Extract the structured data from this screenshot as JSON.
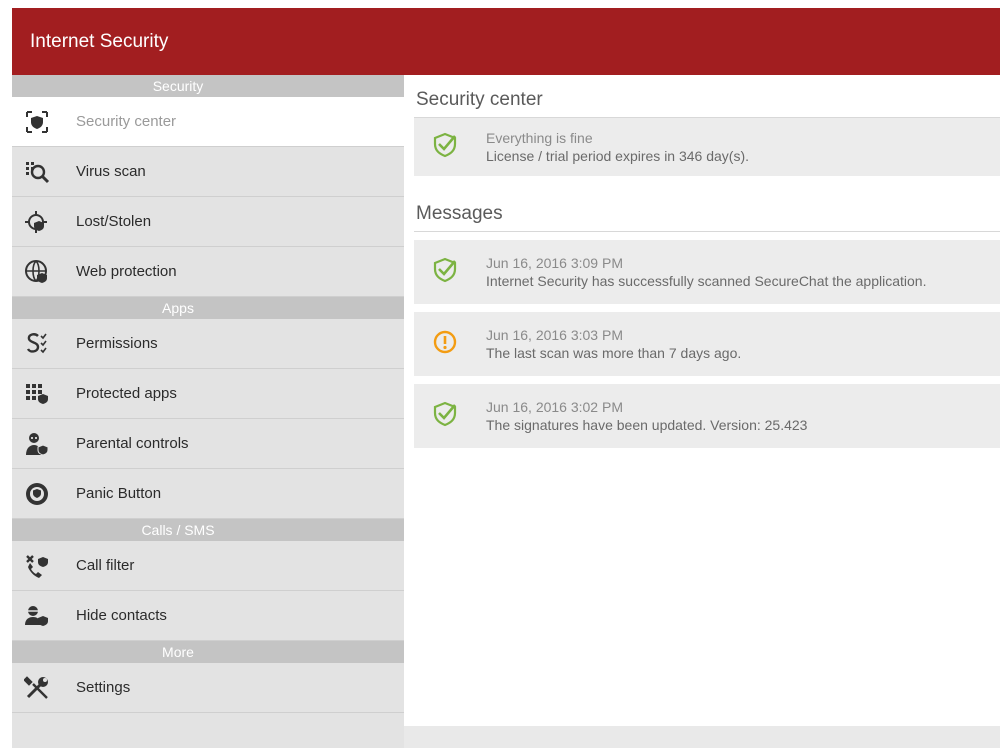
{
  "app": {
    "title": "Internet Security"
  },
  "colors": {
    "brand": "#a21e20",
    "ok": "#7cb342",
    "warning": "#f39c12"
  },
  "sidebar": {
    "sections": [
      {
        "header": "Security",
        "items": [
          {
            "label": "Security center",
            "icon": "shield-scan-icon",
            "active": true
          },
          {
            "label": "Virus scan",
            "icon": "virus-scan-icon"
          },
          {
            "label": "Lost/Stolen",
            "icon": "lost-stolen-icon"
          },
          {
            "label": "Web protection",
            "icon": "globe-shield-icon"
          }
        ]
      },
      {
        "header": "Apps",
        "items": [
          {
            "label": "Permissions",
            "icon": "permissions-icon"
          },
          {
            "label": "Protected apps",
            "icon": "protected-apps-icon"
          },
          {
            "label": "Parental controls",
            "icon": "parental-controls-icon"
          },
          {
            "label": "Panic Button",
            "icon": "panic-button-icon"
          }
        ]
      },
      {
        "header": "Calls / SMS",
        "items": [
          {
            "label": "Call filter",
            "icon": "call-filter-icon"
          },
          {
            "label": "Hide contacts",
            "icon": "hide-contacts-icon"
          }
        ]
      },
      {
        "header": "More",
        "items": [
          {
            "label": "Settings",
            "icon": "wrench-screwdriver-icon"
          }
        ]
      }
    ]
  },
  "main": {
    "security_center": {
      "title": "Security center",
      "status": {
        "icon": "check-shield-icon",
        "line1": "Everything is fine",
        "line2": "License / trial period expires in 346 day(s)."
      }
    },
    "messages": {
      "title": "Messages",
      "items": [
        {
          "icon": "check-shield-icon",
          "time": "Jun 16, 2016 3:09 PM",
          "text": "Internet Security has successfully scanned SecureChat the application."
        },
        {
          "icon": "warning-icon",
          "time": "Jun 16, 2016 3:03 PM",
          "text": "The last scan was more than 7 days ago."
        },
        {
          "icon": "check-shield-icon",
          "time": "Jun 16, 2016 3:02 PM",
          "text": "The signatures have been updated. Version: 25.423"
        }
      ]
    }
  }
}
